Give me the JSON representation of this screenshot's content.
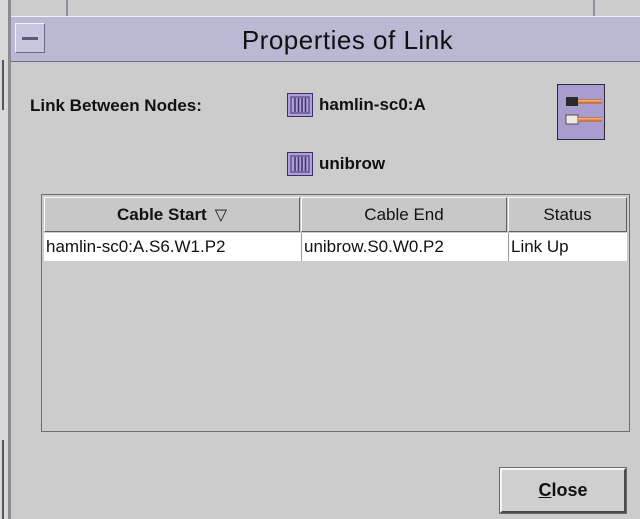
{
  "window": {
    "title": "Properties of Link"
  },
  "link": {
    "label": "Link Between Nodes:",
    "node_a": "hamlin-sc0:A",
    "node_b": "unibrow"
  },
  "table": {
    "columns": [
      {
        "label": "Cable Start",
        "sort_icon": "▽"
      },
      {
        "label": "Cable End"
      },
      {
        "label": "Status"
      }
    ],
    "rows": [
      [
        "hamlin-sc0:A.S6.W1.P2",
        "unibrow.S0.W0.P2",
        "Link Up"
      ]
    ]
  },
  "buttons": {
    "close_mnemonic": "C",
    "close_rest": "lose"
  },
  "icons": {
    "window_menu": "window-menu-icon",
    "node": "node-icon",
    "cable": "cable-icon"
  },
  "colors": {
    "title_bar": "#b9b9d4",
    "node_icon": "#b0a0d8",
    "cable_icon": "#a99ccf",
    "background": "#cccccc"
  }
}
